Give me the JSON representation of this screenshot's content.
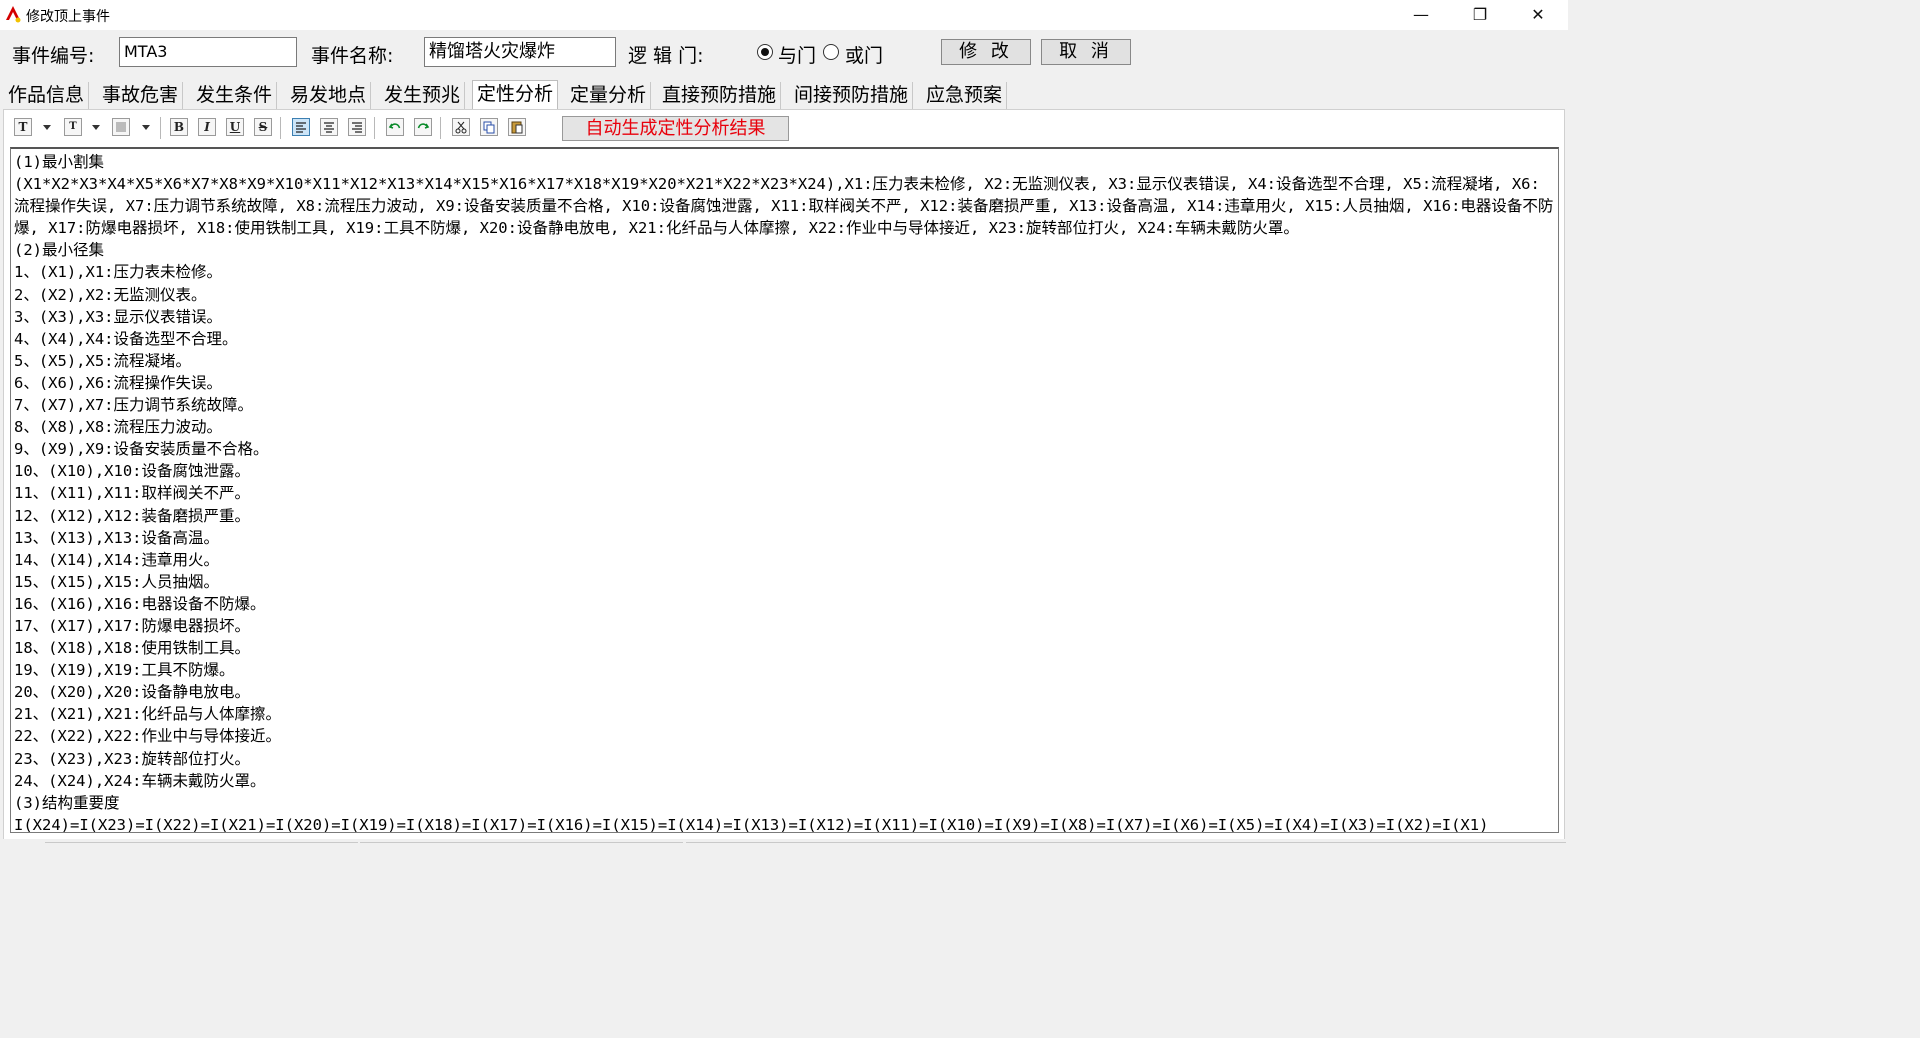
{
  "window": {
    "title": "修改顶上事件",
    "minimize": "—",
    "restore": "❐",
    "close": "✕"
  },
  "header": {
    "event_id_label": "事件编号:",
    "event_id_value": "MTA3",
    "event_name_label": "事件名称:",
    "event_name_value": "精馏塔火灾爆炸",
    "logic_gate_label": "逻 辑 门:",
    "and_gate_label": "与门",
    "or_gate_label": "或门",
    "selected_gate": "与门",
    "modify_button": "修 改",
    "cancel_button": "取 消"
  },
  "tabs": [
    "作品信息",
    "事故危害",
    "发生条件",
    "易发地点",
    "发生预兆",
    "定性分析",
    "定量分析",
    "直接预防措施",
    "间接预防措施",
    "应急预案"
  ],
  "active_tab": "定性分析",
  "toolbar": {
    "text_format_icon": "T",
    "font_size_icon": "T",
    "bold": "B",
    "italic": "I",
    "underline": "U",
    "strike": "S",
    "generate_button": "自动生成定性分析结果"
  },
  "colors": {
    "generate_text": "#e8000b",
    "selected_tool": "#cce4f7"
  },
  "content": {
    "lines": [
      "(1)最小割集",
      "(X1*X2*X3*X4*X5*X6*X7*X8*X9*X10*X11*X12*X13*X14*X15*X16*X17*X18*X19*X20*X21*X22*X23*X24),X1:压力表未检修, X2:无监测仪表, X3:显示仪表错误, X4:设备选型不合理, X5:流程凝堵, X6:流程操作失误, X7:压力调节系统故障, X8:流程压力波动, X9:设备安装质量不合格, X10:设备腐蚀泄露, X11:取样阀关不严, X12:装备磨损严重, X13:设备高温, X14:违章用火, X15:人员抽烟, X16:电器设备不防爆, X17:防爆电器损坏, X18:使用铁制工具, X19:工具不防爆, X20:设备静电放电, X21:化纤品与人体摩擦, X22:作业中与导体接近, X23:旋转部位打火, X24:车辆未戴防火罩。",
      "(2)最小径集",
      "1、(X1),X1:压力表未检修。",
      "2、(X2),X2:无监测仪表。",
      "3、(X3),X3:显示仪表错误。",
      "4、(X4),X4:设备选型不合理。",
      "5、(X5),X5:流程凝堵。",
      "6、(X6),X6:流程操作失误。",
      "7、(X7),X7:压力调节系统故障。",
      "8、(X8),X8:流程压力波动。",
      "9、(X9),X9:设备安装质量不合格。",
      "10、(X10),X10:设备腐蚀泄露。",
      "11、(X11),X11:取样阀关不严。",
      "12、(X12),X12:装备磨损严重。",
      "13、(X13),X13:设备高温。",
      "14、(X14),X14:违章用火。",
      "15、(X15),X15:人员抽烟。",
      "16、(X16),X16:电器设备不防爆。",
      "17、(X17),X17:防爆电器损坏。",
      "18、(X18),X18:使用铁制工具。",
      "19、(X19),X19:工具不防爆。",
      "20、(X20),X20:设备静电放电。",
      "21、(X21),X21:化纤品与人体摩擦。",
      "22、(X22),X22:作业中与导体接近。",
      "23、(X23),X23:旋转部位打火。",
      "24、(X24),X24:车辆未戴防火罩。",
      "(3)结构重要度",
      "I(X24)=I(X23)=I(X22)=I(X21)=I(X20)=I(X19)=I(X18)=I(X17)=I(X16)=I(X15)=I(X14)=I(X13)=I(X12)=I(X11)=I(X10)=I(X9)=I(X8)=I(X7)=I(X6)=I(X5)=I(X4)=I(X3)=I(X2)=I(X1)"
    ]
  }
}
